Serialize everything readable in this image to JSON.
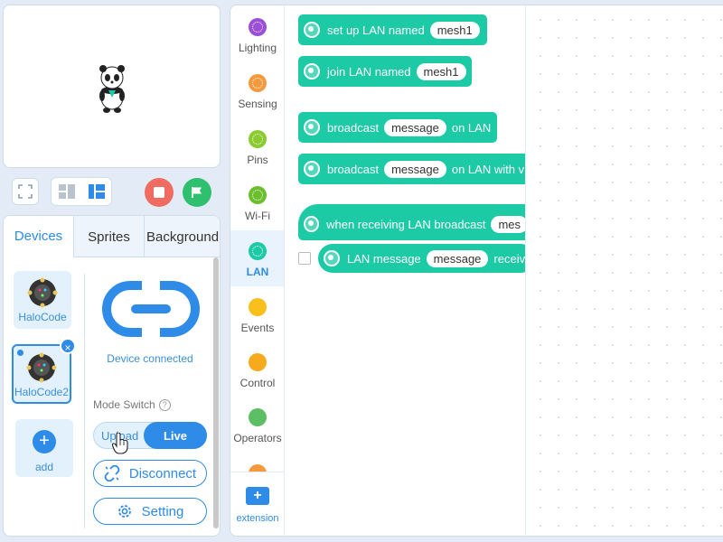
{
  "devices_panel": {
    "tabs": [
      "Devices",
      "Sprites",
      "Background"
    ],
    "devices": [
      {
        "label": "HaloCode"
      },
      {
        "label": "HaloCode2",
        "close": "×"
      }
    ],
    "add_label": "add",
    "status": "Device connected",
    "mode_switch_label": "Mode Switch",
    "mode_help": "?",
    "mode_upload": "Upload",
    "mode_live": "Live",
    "disconnect_label": "Disconnect",
    "setting_label": "Setting"
  },
  "categories": [
    {
      "label": "Lighting",
      "color": "#9b4fd8"
    },
    {
      "label": "Sensing",
      "color": "#f39a3e"
    },
    {
      "label": "Pins",
      "color": "#8acb2f"
    },
    {
      "label": "Wi-Fi",
      "color": "#6cbf2c"
    },
    {
      "label": "LAN",
      "color": "#1ccaa6",
      "active": true
    },
    {
      "label": "Events",
      "color": "#f8bf1d"
    },
    {
      "label": "Control",
      "color": "#f8aa1d"
    },
    {
      "label": "Operators",
      "color": "#5cbf63"
    }
  ],
  "extension_label": "extension",
  "blocks": {
    "b1": {
      "text": "set up LAN named",
      "value": "mesh1"
    },
    "b2": {
      "text": "join LAN named",
      "value": "mesh1"
    },
    "b3": {
      "pre": "broadcast",
      "value": "message",
      "post": "on LAN"
    },
    "b4": {
      "pre": "broadcast",
      "value": "message",
      "post": "on LAN with v"
    },
    "b5": {
      "text": "when receiving LAN broadcast",
      "value": "mes"
    },
    "b6": {
      "pre": "LAN message",
      "value": "message",
      "post": "receiv"
    }
  },
  "colors": {
    "accent": "#2e8be8",
    "lan_block": "#1ccaa6",
    "stop": "#f06b61",
    "go": "#2fc06f"
  }
}
